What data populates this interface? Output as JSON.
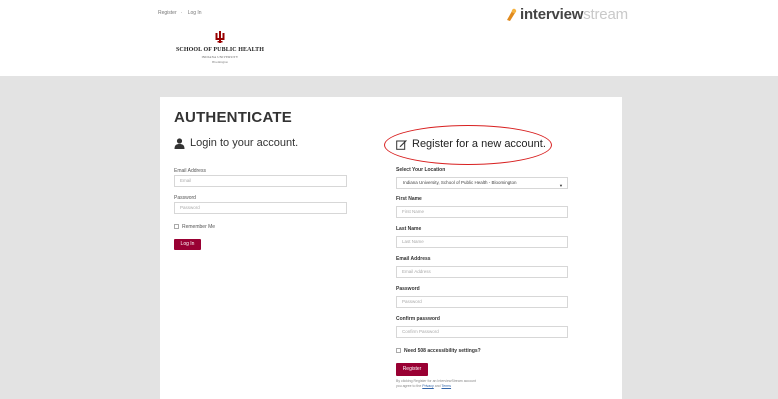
{
  "top_links": {
    "register": "Register",
    "separator": "·",
    "login": "Log In"
  },
  "brand": {
    "part1": "interview",
    "part2": "stream"
  },
  "school": {
    "name": "SCHOOL OF PUBLIC HEALTH",
    "university": "INDIANA UNIVERSITY",
    "campus": "Bloomington"
  },
  "auth": {
    "title": "AUTHENTICATE"
  },
  "login": {
    "heading": "Login to your account.",
    "email_label": "Email Address",
    "email_placeholder": "Email",
    "password_label": "Password",
    "password_placeholder": "Password",
    "remember_label": "Remember Me",
    "button_label": "Log In"
  },
  "register": {
    "heading": "Register for a new account.",
    "location_label": "Select Your Location",
    "location_value": "Indiana University, School of Public Health - Bloomington",
    "first_name_label": "First Name",
    "first_name_placeholder": "First Name",
    "last_name_label": "Last Name",
    "last_name_placeholder": "Last Name",
    "email_label": "Email Address",
    "email_placeholder": "Email Address",
    "password_label": "Password",
    "password_placeholder": "Password",
    "confirm_label": "Confirm password",
    "confirm_placeholder": "Confirm Password",
    "accessibility_label": "Need 508 accessibility settings?",
    "button_label": "Register",
    "fine_print_1": "By clicking Register for an InterviewStream account",
    "fine_print_2": "you agree to the",
    "privacy_link": "Privacy",
    "and_text": "and",
    "terms_link": "Terms"
  },
  "colors": {
    "accent": "#990033",
    "highlight_circle": "#d82020",
    "band": "#e3e3e3"
  },
  "icons": {
    "login": "user-icon",
    "register": "edit-icon",
    "brand": "interviewstream-logo-icon",
    "school": "iu-trident-icon"
  }
}
